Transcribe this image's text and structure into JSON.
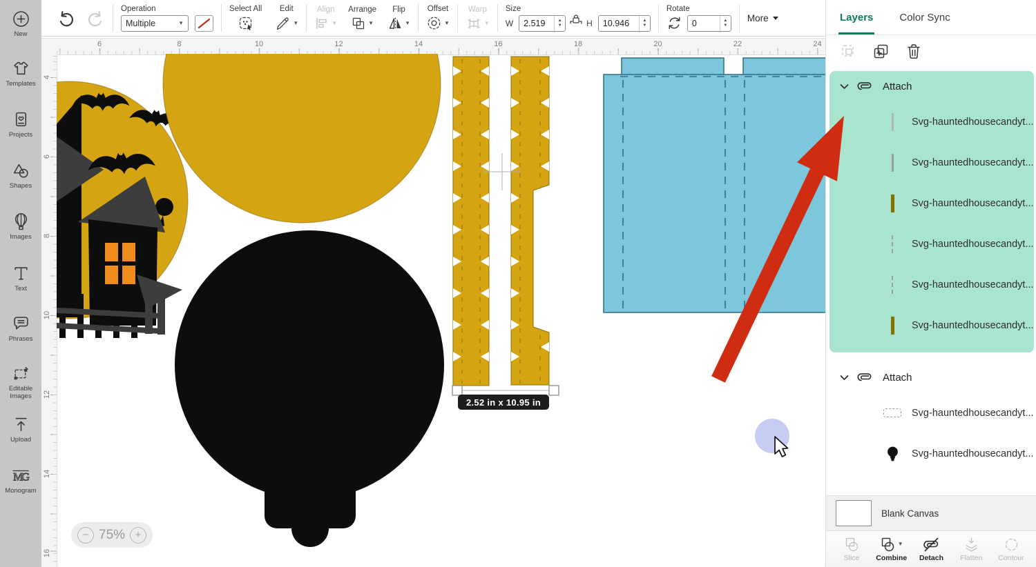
{
  "toolbar": {
    "operation": {
      "label": "Operation",
      "value": "Multiple"
    },
    "select_all": "Select All",
    "edit": "Edit",
    "align": "Align",
    "arrange": "Arrange",
    "flip": "Flip",
    "offset": "Offset",
    "warp": "Warp",
    "size": {
      "label": "Size",
      "w_label": "W",
      "w_value": "2.519",
      "h_label": "H",
      "h_value": "10.946"
    },
    "rotate": {
      "label": "Rotate",
      "value": "0"
    },
    "more": "More"
  },
  "sidebar": {
    "items": [
      {
        "label": "New"
      },
      {
        "label": "Templates"
      },
      {
        "label": "Projects"
      },
      {
        "label": "Shapes"
      },
      {
        "label": "Images"
      },
      {
        "label": "Text"
      },
      {
        "label": "Phrases"
      },
      {
        "label": "Editable Images"
      },
      {
        "label": "Upload"
      },
      {
        "label": "Monogram"
      }
    ]
  },
  "canvas": {
    "ruler": {
      "h_labels": [
        "6",
        "8",
        "10",
        "12",
        "14",
        "16",
        "18",
        "20",
        "22",
        "24"
      ],
      "v_labels": [
        "4",
        "6",
        "8",
        "10",
        "12",
        "14",
        "16"
      ]
    },
    "selection_tooltip": "2.52  in x 10.95  in",
    "zoom": {
      "minus": "−",
      "value": "75%",
      "plus": "+"
    }
  },
  "layers_panel": {
    "tabs": {
      "layers": "Layers",
      "color_sync": "Color Sync"
    },
    "groups": [
      {
        "label": "Attach",
        "items": [
          {
            "label": "Svg-hauntedhousecandyt..."
          },
          {
            "label": "Svg-hauntedhousecandyt..."
          },
          {
            "label": "Svg-hauntedhousecandyt..."
          },
          {
            "label": "Svg-hauntedhousecandyt..."
          },
          {
            "label": "Svg-hauntedhousecandyt..."
          },
          {
            "label": "Svg-hauntedhousecandyt..."
          }
        ]
      },
      {
        "label": "Attach",
        "items": [
          {
            "label": "Svg-hauntedhousecandyt..."
          },
          {
            "label": "Svg-hauntedhousecandyt..."
          }
        ]
      }
    ],
    "blank_canvas": "Blank Canvas",
    "actions": [
      {
        "label": "Slice",
        "enabled": false
      },
      {
        "label": "Combine",
        "enabled": true
      },
      {
        "label": "Detach",
        "enabled": true
      },
      {
        "label": "Flatten",
        "enabled": false
      },
      {
        "label": "Contour",
        "enabled": false
      }
    ]
  },
  "colors": {
    "gold": "#d5a413",
    "gold_stroke": "#8a6f00",
    "ink": "#0d0d0d",
    "dark_gray": "#3d3d3d",
    "orange": "#f08c1c",
    "blue": "#7cc7dc",
    "blue_stroke": "#2f6f84",
    "mint": "#a9e4ce",
    "green": "#0f7c5b",
    "arrow_red": "#cf2c12",
    "cursor_halo": "#c6cbf1"
  }
}
